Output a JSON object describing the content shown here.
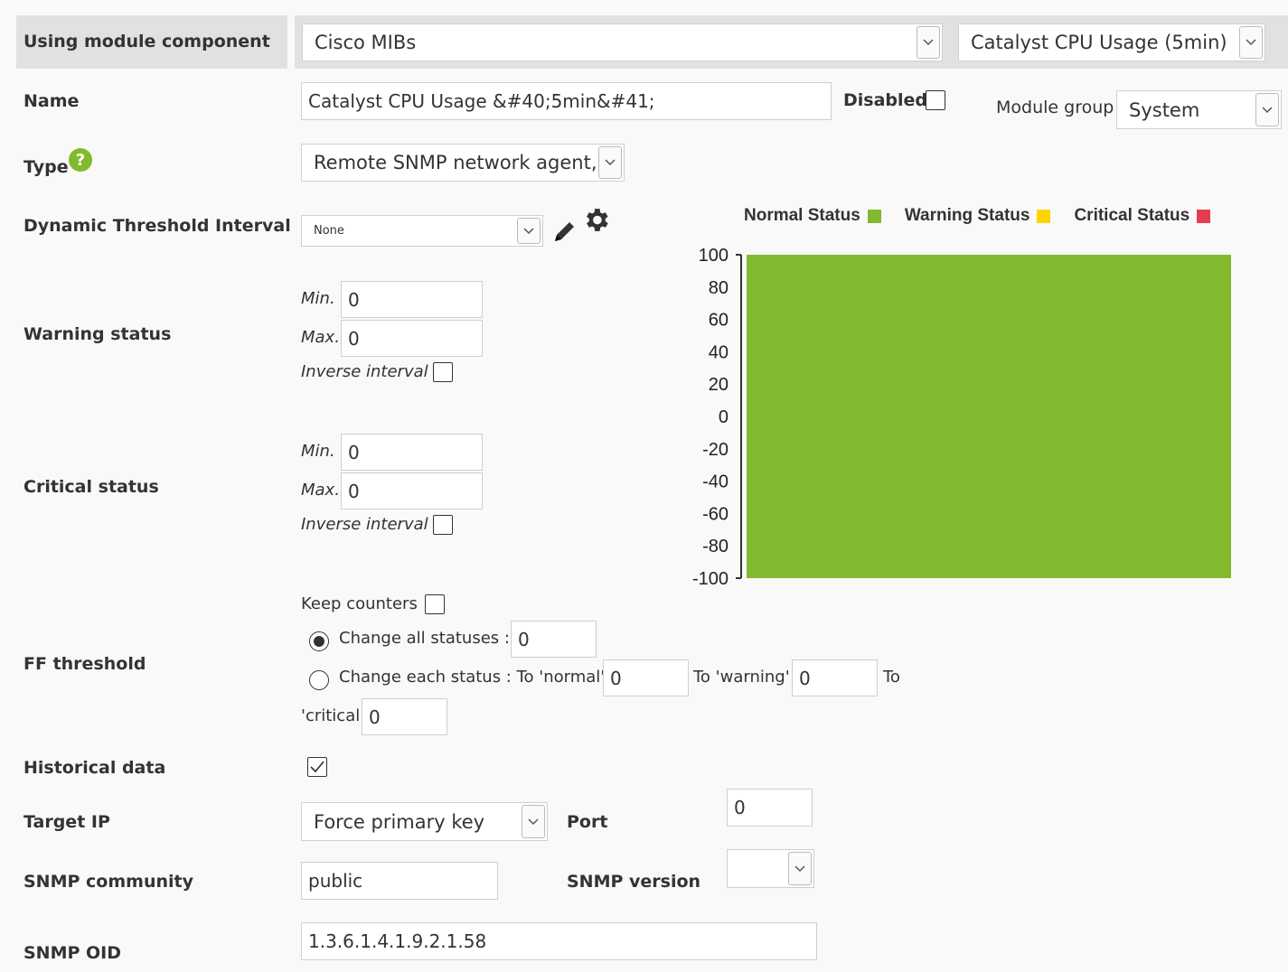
{
  "header": {
    "label": "Using module component",
    "component_select": "Cisco MIBs",
    "module_select": "Catalyst CPU Usage (5min)"
  },
  "name": {
    "label": "Name",
    "value": "Catalyst CPU Usage &#40;5min&#41;",
    "disabled_label": "Disabled",
    "group_label": "Module group",
    "group_value": "System"
  },
  "type": {
    "label": "Type",
    "value": "Remote SNMP network agent,"
  },
  "dynamic": {
    "label": "Dynamic Threshold Interval",
    "value": "None"
  },
  "warning": {
    "label": "Warning status",
    "min_label": "Min.",
    "min_value": "0",
    "max_label": "Max.",
    "max_value": "0",
    "inverse_label": "Inverse interval"
  },
  "critical": {
    "label": "Critical status",
    "min_label": "Min.",
    "min_value": "0",
    "max_label": "Max.",
    "max_value": "0",
    "inverse_label": "Inverse interval"
  },
  "ff": {
    "label": "FF threshold",
    "keep_counters": "Keep counters",
    "change_all": "Change all statuses :",
    "change_all_value": "0",
    "change_each": "Change each status : To 'normal'",
    "normal_value": "0",
    "to_warning": "To 'warning'",
    "warning_value": "0",
    "to": "To",
    "critical_label": "'critical'",
    "critical_value": "0"
  },
  "historical": {
    "label": "Historical data"
  },
  "target_ip": {
    "label": "Target IP",
    "value": "Force primary key",
    "port_label": "Port",
    "port_value": "0"
  },
  "snmp": {
    "community_label": "SNMP community",
    "community_value": "public",
    "version_label": "SNMP version",
    "version_value": "",
    "oid_label": "SNMP OID",
    "oid_value": "1.3.6.1.4.1.9.2.1.58"
  },
  "colors": {
    "normal": "#82b92e",
    "warning": "#fcd500",
    "critical": "#e63c52"
  },
  "chart_data": {
    "type": "bar",
    "legend": [
      "Normal Status",
      "Warning Status",
      "Critical Status"
    ],
    "legend_placement": "top",
    "ylim": [
      -100,
      100
    ],
    "yticks": [
      "100",
      "80",
      "60",
      "40",
      "20",
      "0",
      "-20",
      "-40",
      "-60",
      "-80",
      "-100"
    ],
    "regions": [
      {
        "status": "normal",
        "from": -100,
        "to": 100
      }
    ]
  }
}
